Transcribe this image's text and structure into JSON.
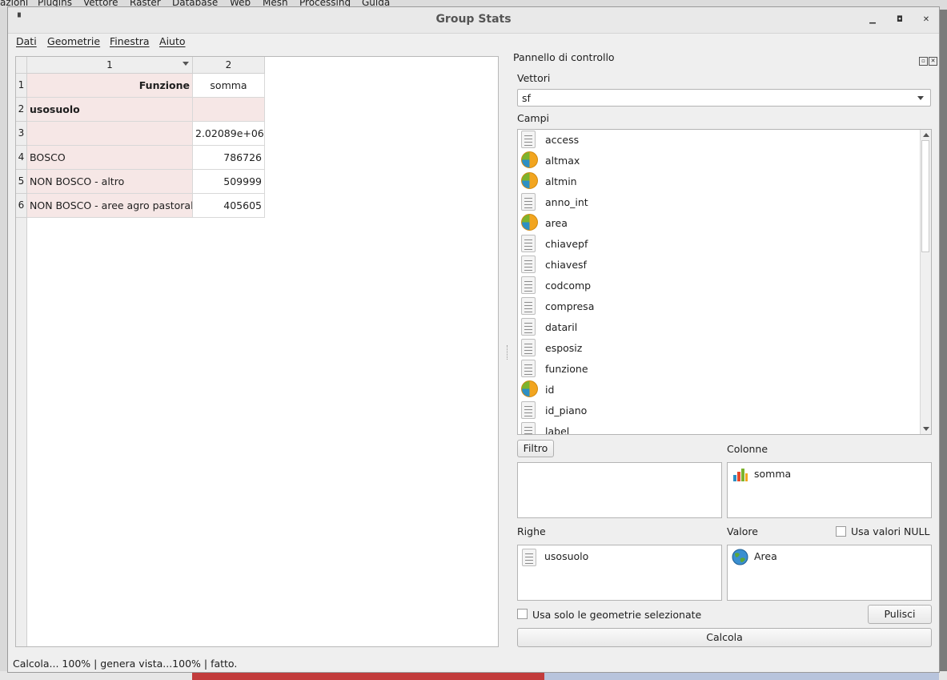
{
  "background_menu": [
    "azioni",
    "Plugins",
    "Vettore",
    "Raster",
    "Database",
    "Web",
    "Mesh",
    "Processing",
    "Guida"
  ],
  "window": {
    "title": "Group Stats"
  },
  "menu": [
    {
      "label_first": "D",
      "label_rest": "ati"
    },
    {
      "label_first": "G",
      "label_rest": "eometrie"
    },
    {
      "label_first": "F",
      "label_rest": "inestra"
    },
    {
      "label_first": "A",
      "label_rest": "iuto"
    }
  ],
  "table": {
    "col_headers": [
      "1",
      "2"
    ],
    "row_headers": [
      "1",
      "2",
      "3",
      "4",
      "5",
      "6"
    ],
    "rows": [
      [
        "Funzione",
        "somma"
      ],
      [
        "usosuolo",
        ""
      ],
      [
        "",
        "2.02089e+06"
      ],
      [
        "BOSCO",
        "786726"
      ],
      [
        "NON BOSCO - altro",
        "509999"
      ],
      [
        "NON BOSCO - aree agro pastorali",
        "405605"
      ]
    ]
  },
  "panel": {
    "title": "Pannello di controllo",
    "vettori_label": "Vettori",
    "vettori_value": "sf",
    "campi_label": "Campi",
    "fields": [
      {
        "name": "access",
        "icon": "text-field-icon"
      },
      {
        "name": "altmax",
        "icon": "numeric-field-icon"
      },
      {
        "name": "altmin",
        "icon": "numeric-field-icon"
      },
      {
        "name": "anno_int",
        "icon": "text-field-icon"
      },
      {
        "name": "area",
        "icon": "numeric-field-icon"
      },
      {
        "name": "chiavepf",
        "icon": "text-field-icon"
      },
      {
        "name": "chiavesf",
        "icon": "text-field-icon"
      },
      {
        "name": "codcomp",
        "icon": "text-field-icon"
      },
      {
        "name": "compresa",
        "icon": "text-field-icon"
      },
      {
        "name": "dataril",
        "icon": "text-field-icon"
      },
      {
        "name": "esposiz",
        "icon": "text-field-icon"
      },
      {
        "name": "funzione",
        "icon": "text-field-icon"
      },
      {
        "name": "id",
        "icon": "numeric-field-icon"
      },
      {
        "name": "id_piano",
        "icon": "text-field-icon"
      },
      {
        "name": "label",
        "icon": "text-field-icon"
      }
    ],
    "filtro_button": "Filtro",
    "colonne_label": "Colonne",
    "colonne_item": "somma",
    "righe_label": "Righe",
    "righe_item": "usosuolo",
    "valore_label": "Valore",
    "valore_item": "Area",
    "null_checkbox_label": "Usa valori NULL",
    "selected_checkbox_label": "Usa solo le geometrie selezionate",
    "pulisci_button": "Pulisci",
    "calcola_button": "Calcola"
  },
  "status": "Calcola... 100% |  genera vista...100% |  fatto."
}
